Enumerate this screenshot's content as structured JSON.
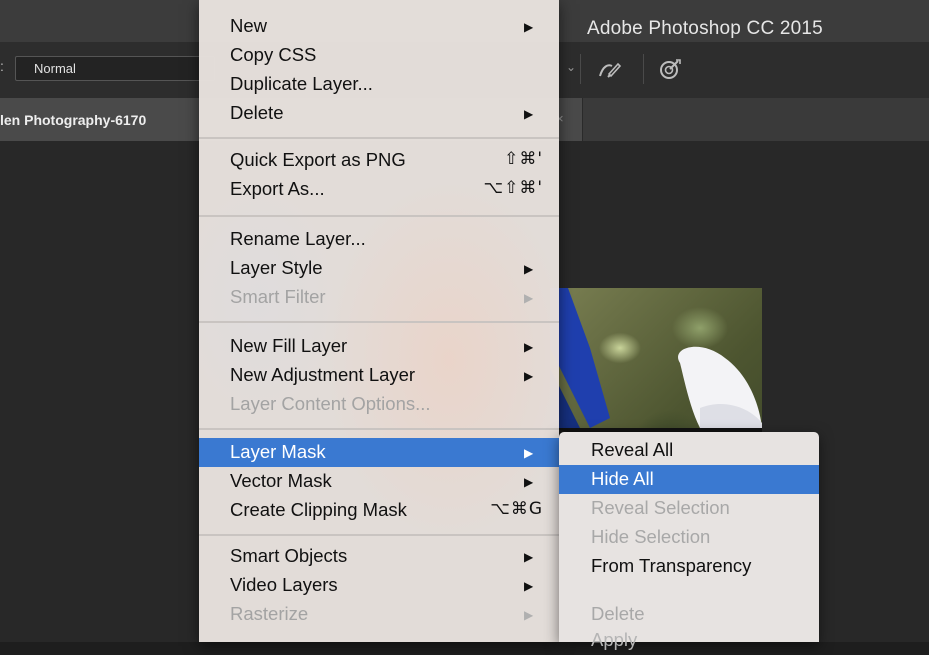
{
  "app": {
    "title": "Adobe Photoshop CC 2015"
  },
  "options_bar": {
    "mode_prefix": ":",
    "mode_value": "Normal",
    "chevron": "⌄",
    "icons": [
      "pressure-brush-icon",
      "target-icon"
    ]
  },
  "document_tab": {
    "label": "len Photography-6170",
    "close": "×"
  },
  "context_menu": {
    "items": [
      {
        "label": "New",
        "submenu": true,
        "shortcut": ""
      },
      {
        "label": "Copy CSS",
        "submenu": false,
        "shortcut": ""
      },
      {
        "label": "Duplicate Layer...",
        "submenu": false,
        "shortcut": ""
      },
      {
        "label": "Delete",
        "submenu": true,
        "shortcut": ""
      },
      {
        "label": "Quick Export as PNG",
        "submenu": false,
        "shortcut": "⇧⌘'"
      },
      {
        "label": "Export As...",
        "submenu": false,
        "shortcut": "⌥⇧⌘'"
      },
      {
        "label": "Rename Layer...",
        "submenu": false,
        "shortcut": ""
      },
      {
        "label": "Layer Style",
        "submenu": true,
        "shortcut": ""
      },
      {
        "label": "Smart Filter",
        "submenu": true,
        "shortcut": "",
        "disabled": true
      },
      {
        "label": "New Fill Layer",
        "submenu": true,
        "shortcut": ""
      },
      {
        "label": "New Adjustment Layer",
        "submenu": true,
        "shortcut": ""
      },
      {
        "label": "Layer Content Options...",
        "submenu": false,
        "shortcut": "",
        "disabled": true
      },
      {
        "label": "Layer Mask",
        "submenu": true,
        "shortcut": "",
        "highlighted": true
      },
      {
        "label": "Vector Mask",
        "submenu": true,
        "shortcut": ""
      },
      {
        "label": "Create Clipping Mask",
        "submenu": false,
        "shortcut": "⌥⌘G"
      },
      {
        "label": "Smart Objects",
        "submenu": true,
        "shortcut": ""
      },
      {
        "label": "Video Layers",
        "submenu": true,
        "shortcut": ""
      },
      {
        "label": "Rasterize",
        "submenu": true,
        "shortcut": "",
        "disabled": true
      }
    ],
    "submenu_arrow": "▶"
  },
  "layer_mask_submenu": {
    "items": [
      {
        "label": "Reveal All"
      },
      {
        "label": "Hide All",
        "highlighted": true
      },
      {
        "label": "Reveal Selection",
        "disabled": true
      },
      {
        "label": "Hide Selection",
        "disabled": true
      },
      {
        "label": "From Transparency"
      },
      {
        "label": "Delete",
        "disabled": true
      },
      {
        "label": "Apply",
        "disabled": true
      }
    ]
  }
}
